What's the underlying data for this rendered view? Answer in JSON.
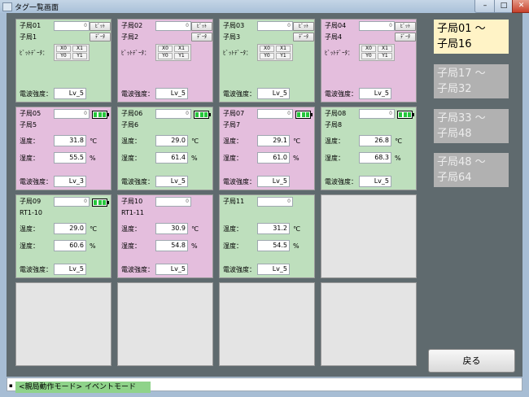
{
  "window": {
    "title": "タグ一覧画面",
    "min": "–",
    "max": "□",
    "close": "✕"
  },
  "colors": {
    "green": "#bedfbd",
    "pink": "#e4bedd",
    "empty": "#e4e4e4",
    "active": "#fff3c6",
    "inactive": "#b1b1b1",
    "status": "#8fd38a"
  },
  "labels": {
    "bitdata": "ﾋﾞｯﾄﾃﾞｰﾀ：",
    "temp": "温度：",
    "humid": "湿度：",
    "signal": "電波強度：",
    "unit_c": "℃",
    "unit_pct": "%",
    "btn_bit": "ﾋﾞｯﾄ",
    "btn_data": "ﾃﾞｰﾀ",
    "x0": "X0",
    "x1": "X1",
    "y0": "Y0",
    "y1": "Y1"
  },
  "cells": [
    {
      "id": "子局01",
      "sub": "子局1",
      "id_value": "0",
      "signal": "Lv_5",
      "color": "green"
    },
    {
      "id": "子局02",
      "sub": "子局2",
      "id_value": "0",
      "signal": "Lv_5",
      "color": "pink"
    },
    {
      "id": "子局03",
      "sub": "子局3",
      "id_value": "0",
      "signal": "Lv_5",
      "color": "green"
    },
    {
      "id": "子局04",
      "sub": "子局4",
      "id_value": "0",
      "signal": "Lv_5",
      "color": "pink"
    },
    {
      "id": "子局05",
      "sub": "子局5",
      "id_value": "0",
      "temp": "31.8",
      "humid": "55.5",
      "signal": "Lv_3",
      "color": "pink",
      "battery_level": 1.0
    },
    {
      "id": "子局06",
      "sub": "子局6",
      "id_value": "0",
      "temp": "29.0",
      "humid": "61.4",
      "signal": "Lv_5",
      "color": "green",
      "battery_level": 1.0
    },
    {
      "id": "子局07",
      "sub": "子局7",
      "id_value": "0",
      "temp": "29.1",
      "humid": "61.0",
      "signal": "Lv_5",
      "color": "pink",
      "battery_level": 1.0
    },
    {
      "id": "子局08",
      "sub": "子局8",
      "id_value": "0",
      "temp": "26.8",
      "humid": "68.3",
      "signal": "Lv_5",
      "color": "green",
      "battery_level": 1.0
    },
    {
      "id": "子局09",
      "sub": "RT1-10",
      "id_value": "0",
      "temp": "29.0",
      "humid": "60.6",
      "signal": "Lv_5",
      "color": "green",
      "battery_level": 1.0
    },
    {
      "id": "子局10",
      "sub": "RT1-11",
      "id_value": "0",
      "temp": "30.9",
      "humid": "54.8",
      "signal": "Lv_5",
      "color": "pink"
    },
    {
      "id": "子局11",
      "sub": "",
      "id_value": "0",
      "temp": "31.2",
      "humid": "54.5",
      "signal": "Lv_5",
      "color": "green"
    }
  ],
  "sidebar": [
    {
      "line1": "子局01 〜",
      "line2": "子局16",
      "active": true
    },
    {
      "line1": "子局17 〜",
      "line2": "子局32",
      "active": false
    },
    {
      "line1": "子局33 〜",
      "line2": "子局48",
      "active": false
    },
    {
      "line1": "子局48 〜",
      "line2": "子局64",
      "active": false
    }
  ],
  "back_button": "戻る",
  "status": {
    "mode": "<親局動作モード> イベントモード",
    "grip_icon": "resize-grip-icon"
  }
}
